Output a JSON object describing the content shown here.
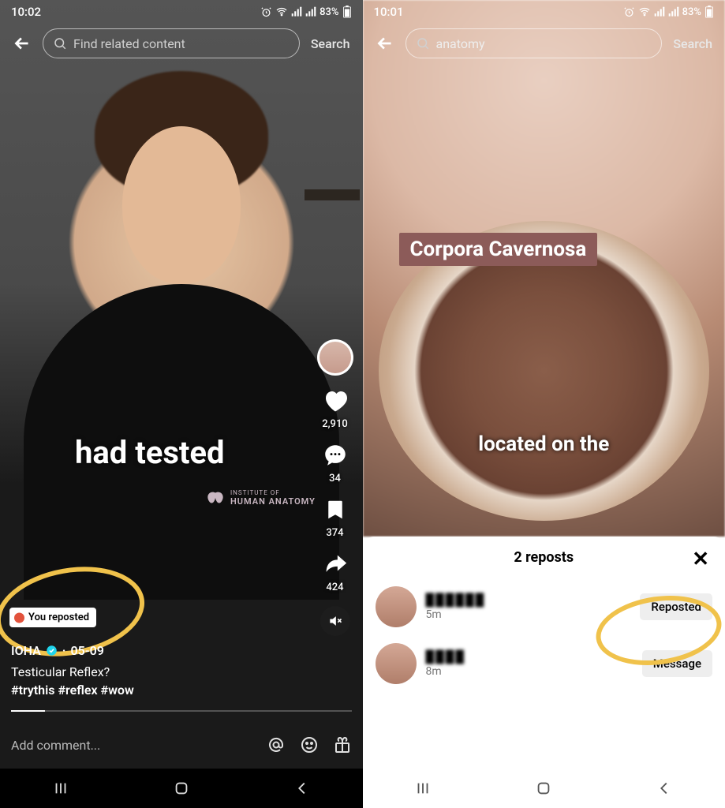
{
  "left": {
    "status": {
      "time": "10:02",
      "battery": "83%"
    },
    "search_placeholder": "Find related content",
    "search_button": "Search",
    "video_caption": "had tested",
    "brand_line1": "INSTITUTE OF",
    "brand_line2": "HUMAN ANATOMY",
    "actions": {
      "likes": "2,910",
      "comments": "34",
      "saves": "374",
      "shares": "424"
    },
    "repost_chip": "You reposted",
    "username": "IOHA",
    "date": "05-09",
    "title": "Testicular Reflex?",
    "tags": "#trythis #reflex #wow",
    "comment_placeholder": "Add comment..."
  },
  "right": {
    "status": {
      "time": "10:01",
      "battery": "83%"
    },
    "search_value": "anatomy",
    "search_button": "Search",
    "label_text": "Corpora Cavernosa",
    "caption": "located on the",
    "sheet": {
      "title": "2 reposts",
      "rows": [
        {
          "name": "██████",
          "time": "5m",
          "button": "Reposted"
        },
        {
          "name": "████",
          "time": "8m",
          "button": "Message"
        }
      ]
    }
  }
}
